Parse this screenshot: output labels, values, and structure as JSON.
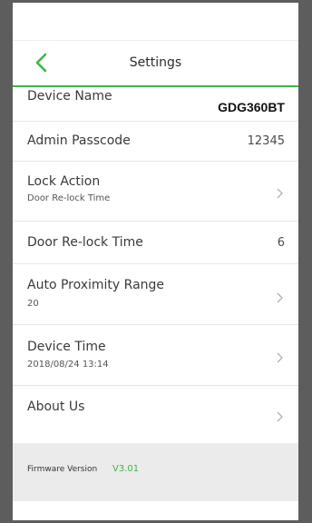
{
  "header": {
    "title": "Settings",
    "accent_color": "#3bb54a"
  },
  "settings": [
    {
      "label": "Device Name",
      "value": "GDG360BT"
    },
    {
      "label": "Admin Passcode",
      "value": "12345"
    },
    {
      "label": "Lock Action",
      "subtitle": "Door Re-lock Time",
      "chevron": true
    },
    {
      "label": "Door Re-lock Time",
      "value": "6"
    },
    {
      "label": "Auto Proximity Range",
      "subtitle": "20",
      "chevron": true
    },
    {
      "label": "Device Time",
      "subtitle": "2018/08/24 13:14",
      "chevron": true
    },
    {
      "label": "About Us",
      "chevron": true
    }
  ],
  "footer": {
    "firmware_label": "Firmware Version",
    "firmware_value": "V3.01"
  }
}
